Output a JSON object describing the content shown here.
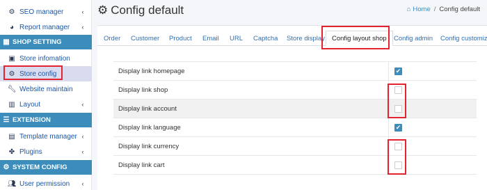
{
  "sidebar": {
    "items_top": [
      {
        "label": "SEO manager",
        "icon": "gear-icon",
        "chev": "‹"
      },
      {
        "label": "Report manager",
        "icon": "pie-chart-icon",
        "chev": "‹"
      }
    ],
    "section_shop": "SHOP SETTING",
    "shop_items": [
      {
        "label": "Store infomation",
        "icon": "store-icon"
      },
      {
        "label": "Store config",
        "icon": "gear-icon"
      },
      {
        "label": "Website maintain",
        "icon": "wrench-icon"
      },
      {
        "label": "Layout",
        "icon": "layout-icon",
        "chev": "‹"
      }
    ],
    "section_extension": "EXTENSION",
    "extension_items": [
      {
        "label": "Template manager",
        "icon": "template-icon",
        "chev": "‹"
      },
      {
        "label": "Plugins",
        "icon": "puzzle-icon",
        "chev": "‹"
      }
    ],
    "section_system": "SYSTEM CONFIG",
    "system_items": [
      {
        "label": "User permission",
        "icon": "users-icon",
        "chev": "‹"
      }
    ]
  },
  "header": {
    "title": "Config default",
    "breadcrumb_home": "Home",
    "breadcrumb_sep": "/",
    "breadcrumb_current": "Config default"
  },
  "tabs": [
    "Order",
    "Customer",
    "Product",
    "Email",
    "URL",
    "Captcha",
    "Store display",
    "Config layout shop",
    "Config admin",
    "Config customize"
  ],
  "active_tab": "Config layout shop",
  "settings": [
    {
      "label": "Display link homepage",
      "checked": true
    },
    {
      "label": "Display link shop",
      "checked": false
    },
    {
      "label": "Display link account",
      "checked": false
    },
    {
      "label": "Display link language",
      "checked": true
    },
    {
      "label": "Display link currency",
      "checked": false
    },
    {
      "label": "Display link cart",
      "checked": false
    }
  ],
  "colors": {
    "accent": "#3c8dbc",
    "highlight": "#e3232f"
  }
}
